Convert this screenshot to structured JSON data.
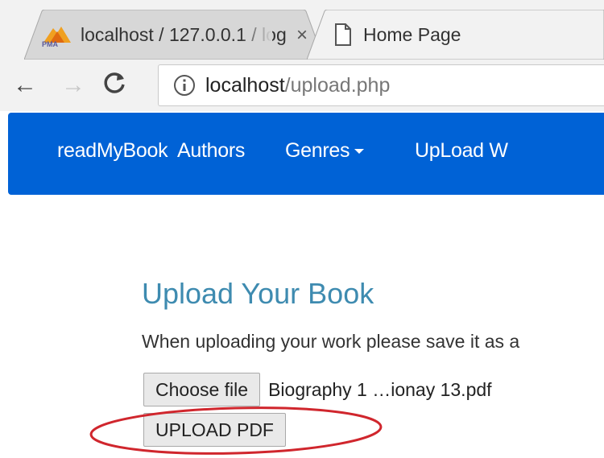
{
  "browser": {
    "tabs": [
      {
        "label": "localhost / 127.0.0.1 / log",
        "close": "×",
        "icon": "phpmyadmin-icon"
      },
      {
        "label": "Home Page",
        "icon": "page-icon"
      }
    ],
    "nav": {
      "back": "←",
      "forward": "→",
      "reload": "C"
    },
    "url": {
      "host": "localhost",
      "path": "/upload.php"
    }
  },
  "navbar": {
    "brand": "readMyBook",
    "items": [
      {
        "label": "Authors"
      },
      {
        "label": "Genres"
      },
      {
        "label": "UpLoad W"
      }
    ],
    "color": "#0062d6"
  },
  "page": {
    "title": "Upload Your Book",
    "description": "When uploading your work please save it as a",
    "file_input": {
      "button_label": "Choose file",
      "file_name": "Biography 1 …ionay 13.pdf"
    },
    "upload_button": "UPLOAD PDF",
    "title_color": "#3e8bb0",
    "annotation_color": "#d0262d"
  }
}
